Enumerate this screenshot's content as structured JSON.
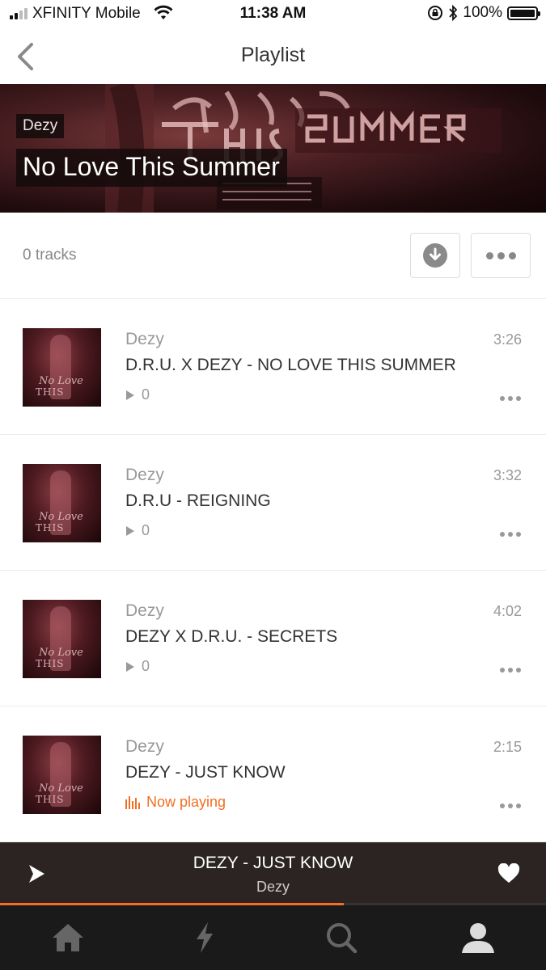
{
  "status_bar": {
    "carrier": "XFINITY Mobile",
    "time": "11:38 AM",
    "battery": "100%"
  },
  "nav": {
    "title": "Playlist",
    "back_icon": "chevron-left-icon"
  },
  "playlist": {
    "artist": "Dezy",
    "title": "No Love This Summer",
    "track_count": "0 tracks"
  },
  "tracks": [
    {
      "artist": "Dezy",
      "title": "D.R.U. X DEZY - NO LOVE THIS SUMMER",
      "duration": "3:26",
      "plays": "0"
    },
    {
      "artist": "Dezy",
      "title": "D.R.U - REIGNING",
      "duration": "3:32",
      "plays": "0"
    },
    {
      "artist": "Dezy",
      "title": "DEZY X D.R.U. - SECRETS",
      "duration": "4:02",
      "plays": "0"
    },
    {
      "artist": "Dezy",
      "title": "DEZY - JUST KNOW",
      "duration": "2:15",
      "status": "Now playing"
    }
  ],
  "player": {
    "title": "DEZY - JUST KNOW",
    "artist": "Dezy",
    "progress": 0.63
  },
  "colors": {
    "accent": "#f26f23",
    "player_bg": "#2c2323",
    "tabbar_bg": "#1a1a1a"
  },
  "tabbar": {
    "items": [
      "home-icon",
      "stream-icon",
      "search-icon",
      "profile-icon"
    ]
  }
}
